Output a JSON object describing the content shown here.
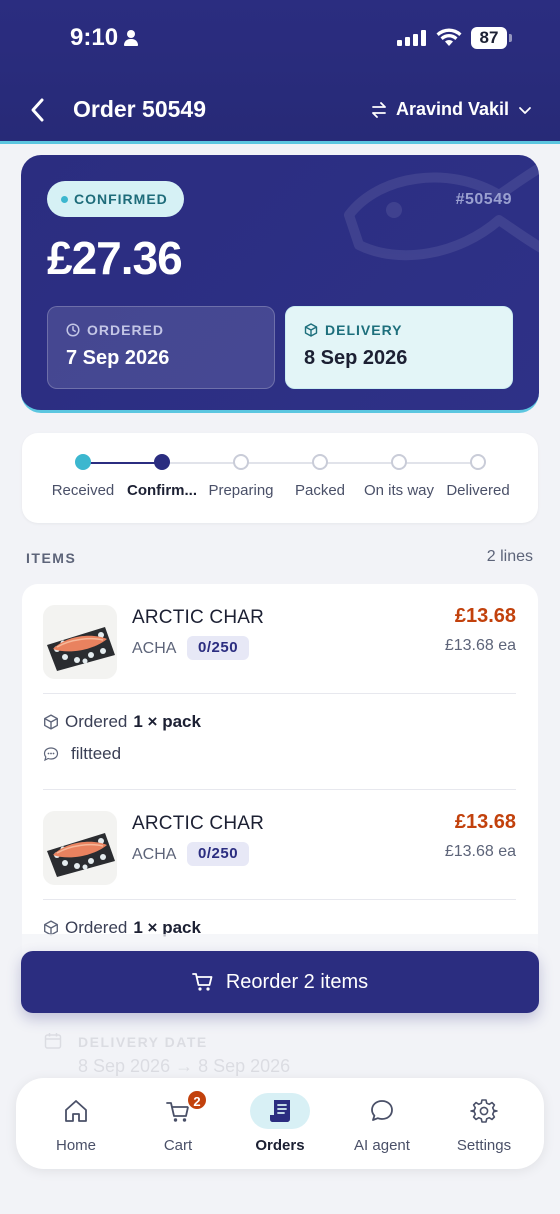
{
  "status_bar": {
    "time": "9:10",
    "battery": "87"
  },
  "header": {
    "title": "Order 50549",
    "account_name": "Aravind Vakil"
  },
  "summary": {
    "status_badge": "CONFIRMED",
    "order_ref": "#50549",
    "amount": "£27.36",
    "ordered_label": "ORDERED",
    "ordered_date": "7 Sep 2026",
    "delivery_label": "DELIVERY",
    "delivery_date": "8 Sep 2026"
  },
  "progress": {
    "current_step": 2,
    "steps": [
      "Received",
      "Confirm...",
      "Preparing",
      "Packed",
      "On its way",
      "Delivered"
    ]
  },
  "items_section": {
    "title": "ITEMS",
    "count": "2 lines"
  },
  "items": [
    {
      "name": "ARCTIC CHAR",
      "code": "ACHA",
      "stock": "0/250",
      "price": "£13.68",
      "unit_price": "£13.68 ea",
      "ordered_prefix": "Ordered",
      "ordered_qty": "1 × pack",
      "note": "filtteed"
    },
    {
      "name": "ARCTIC CHAR",
      "code": "ACHA",
      "stock": "0/250",
      "price": "£13.68",
      "unit_price": "£13.68 ea",
      "ordered_prefix": "Ordered",
      "ordered_qty": "1 × pack"
    }
  ],
  "faded_section": {
    "label": "DELIVERY DATE",
    "value": "8 Sep 2026 → 8 Sep 2026"
  },
  "reorder_button": "Reorder 2 items",
  "tabbar": {
    "cart_badge": "2",
    "tabs": [
      {
        "label": "Home",
        "icon": "home-icon"
      },
      {
        "label": "Cart",
        "icon": "cart-icon"
      },
      {
        "label": "Orders",
        "icon": "orders-icon"
      },
      {
        "label": "AI agent",
        "icon": "chat-icon"
      },
      {
        "label": "Settings",
        "icon": "gear-icon"
      }
    ],
    "active": "Orders"
  },
  "colors": {
    "brand": "#2b2d80",
    "accent": "#3cb7cf",
    "price": "#c2410c"
  }
}
